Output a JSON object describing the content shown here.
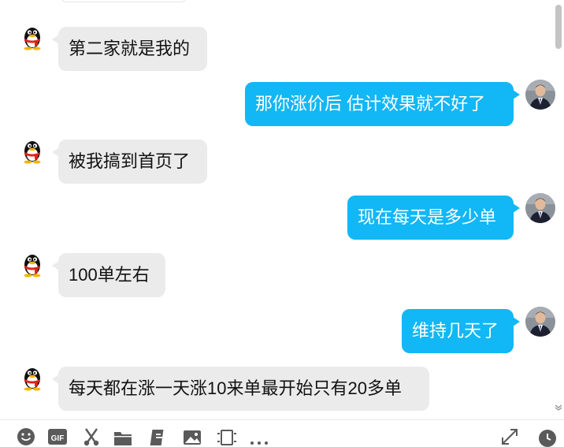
{
  "window": {
    "title": ""
  },
  "messages": [
    {
      "direction": "in",
      "avatar": "qq-penguin-avatar",
      "text": "第二家就是我的"
    },
    {
      "direction": "out",
      "avatar": "user-photo-avatar",
      "text": "那你涨价后  估计效果就不好了"
    },
    {
      "direction": "in",
      "avatar": "qq-penguin-avatar",
      "text": "被我搞到首页了"
    },
    {
      "direction": "out",
      "avatar": "user-photo-avatar",
      "text": "现在每天是多少单"
    },
    {
      "direction": "in",
      "avatar": "qq-penguin-avatar",
      "text": "100单左右"
    },
    {
      "direction": "out",
      "avatar": "user-photo-avatar",
      "text": "维持几天了"
    },
    {
      "direction": "in",
      "avatar": "qq-penguin-avatar",
      "text": "每天都在涨一天涨10来单最开始只有20多单"
    }
  ],
  "toolbar": {
    "tools": [
      {
        "icon": "emoji-icon"
      },
      {
        "icon": "gif-icon",
        "label": "GIF"
      },
      {
        "icon": "scissors-icon"
      },
      {
        "icon": "folder-icon"
      },
      {
        "icon": "tencent-doc-icon"
      },
      {
        "icon": "image-icon"
      },
      {
        "icon": "screen-record-icon"
      },
      {
        "icon": "more-icon",
        "label": "···"
      },
      {
        "icon": "expand-icon"
      },
      {
        "icon": "history-clock-icon"
      }
    ]
  },
  "colors": {
    "incoming_bubble": "#ebebeb",
    "outgoing_bubble": "#12b7f5",
    "outgoing_text": "#ffffff",
    "incoming_text": "#111111"
  }
}
